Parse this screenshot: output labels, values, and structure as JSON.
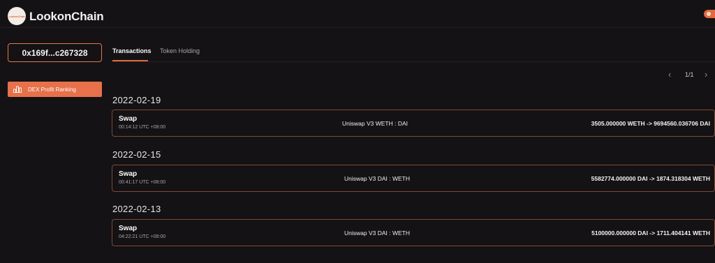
{
  "app": {
    "brand": "LookonChain",
    "logo_text": "LookonChain"
  },
  "sidebar": {
    "address": "0x169f...c267328",
    "items": [
      {
        "label": "DEX Profit Ranking",
        "icon": "ranking-icon",
        "active": true
      }
    ]
  },
  "tabs": [
    {
      "label": "Transactions",
      "active": true
    },
    {
      "label": "Token Holding",
      "active": false
    }
  ],
  "pagination": {
    "prev_icon": "chevron-left-icon",
    "page": "1/1",
    "next_icon": "chevron-right-icon"
  },
  "groups": [
    {
      "date": "2022-02-19",
      "transactions": [
        {
          "type": "Swap",
          "time": "00:14:12 UTC +08:00",
          "pair": "Uniswap V3 WETH : DAI",
          "amount": "3505.000000 WETH -> 9694560.036706 DAI"
        }
      ]
    },
    {
      "date": "2022-02-15",
      "transactions": [
        {
          "type": "Swap",
          "time": "00:41:17 UTC +08:00",
          "pair": "Uniswap V3 DAI : WETH",
          "amount": "5582774.000000 DAI -> 1874.318304 WETH"
        }
      ]
    },
    {
      "date": "2022-02-13",
      "transactions": [
        {
          "type": "Swap",
          "time": "04:22:21 UTC +08:00",
          "pair": "Uniswap V3 DAI : WETH",
          "amount": "5100000.000000 DAI -> 1711.404141 WETH"
        }
      ]
    }
  ],
  "colors": {
    "background": "#141214",
    "accent": "#e26a3e",
    "row_border": "#7d4a38"
  }
}
